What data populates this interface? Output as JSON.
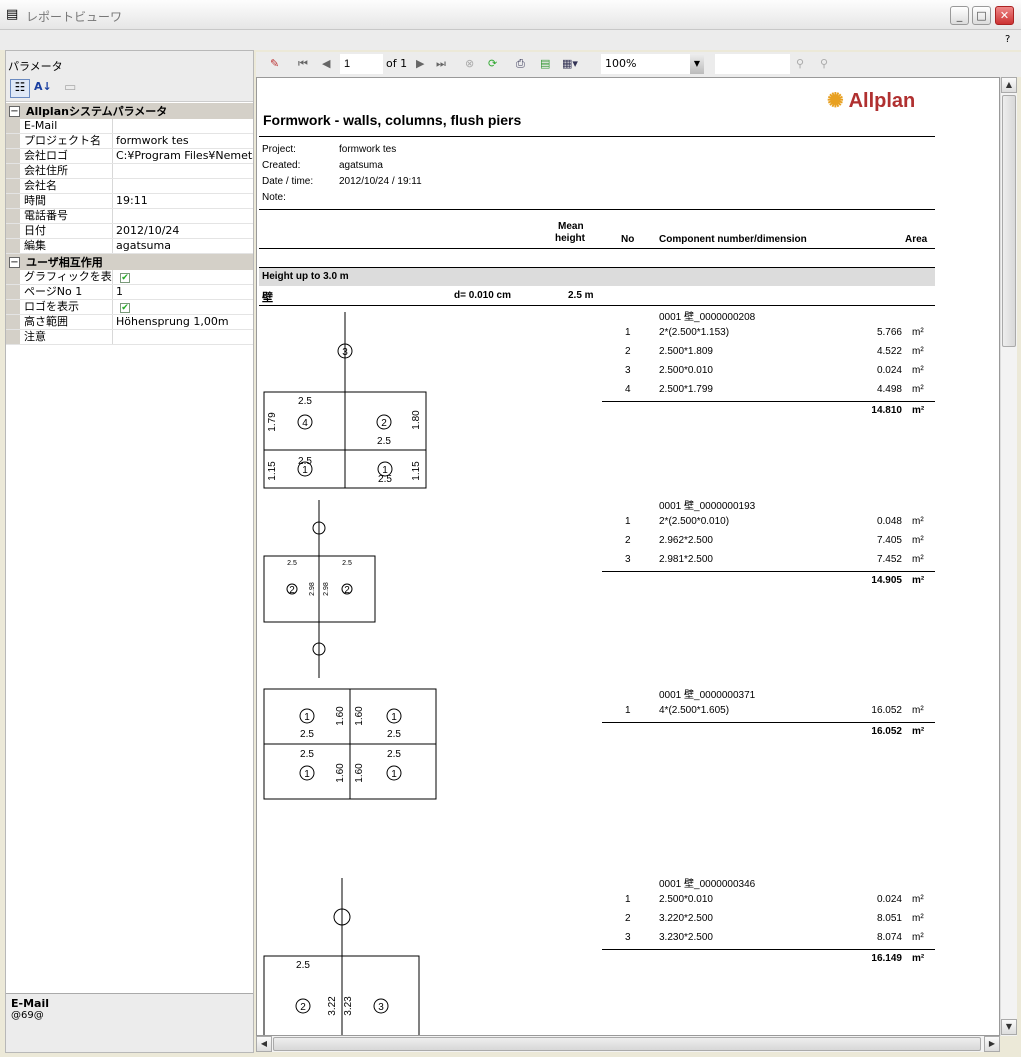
{
  "window": {
    "title": "レポートビューワ",
    "help": "?"
  },
  "left": {
    "title": "パラメータ",
    "categories": [
      {
        "name": "Allplanシステムパラメータ",
        "rows": [
          {
            "k": "E-Mail",
            "v": ""
          },
          {
            "k": "プロジェクト名",
            "v": "formwork tes"
          },
          {
            "k": "会社ロゴ",
            "v": "C:¥Program Files¥Nemetsc"
          },
          {
            "k": "会社住所",
            "v": ""
          },
          {
            "k": "会社名",
            "v": ""
          },
          {
            "k": "時間",
            "v": "19:11"
          },
          {
            "k": "電話番号",
            "v": ""
          },
          {
            "k": "日付",
            "v": "2012/10/24"
          },
          {
            "k": "編集",
            "v": "agatsuma"
          }
        ]
      },
      {
        "name": "ユーザ相互作用",
        "rows": [
          {
            "k": "グラフィックを表示",
            "v": "",
            "check": true
          },
          {
            "k": "ページNo 1",
            "v": "1"
          },
          {
            "k": "ロゴを表示",
            "v": "",
            "check": true
          },
          {
            "k": "高さ範囲",
            "v": "Höhensprung 1,00m"
          },
          {
            "k": "注意",
            "v": ""
          }
        ]
      }
    ],
    "desc": {
      "title": "E-Mail",
      "text": "@69@"
    }
  },
  "toolbar": {
    "page": "1",
    "of": "of 1",
    "zoom": "100%",
    "find": ""
  },
  "report": {
    "logo": "Allplan",
    "title": "Formwork - walls, columns, flush piers",
    "meta": [
      {
        "k": "Project:",
        "v": "formwork tes"
      },
      {
        "k": "Created:",
        "v": "agatsuma"
      },
      {
        "k": "Date / time:",
        "v": "2012/10/24  /  19:11"
      },
      {
        "k": "Note:",
        "v": ""
      }
    ],
    "headers": {
      "mean1": "Mean",
      "mean2": "height",
      "no": "No",
      "comp": "Component number/dimension",
      "area": "Area"
    },
    "group": "Height up to 3.0 m",
    "item": {
      "name": "壁",
      "d": "d= 0.010 cm",
      "h": "2.5 m"
    },
    "unit": "m²",
    "blocks": [
      {
        "id": "0001 壁_0000000208",
        "rows": [
          [
            "1",
            "2*(2.500*1.153)",
            "5.766"
          ],
          [
            "2",
            "2.500*1.809",
            "4.522"
          ],
          [
            "3",
            "2.500*0.010",
            "0.024"
          ],
          [
            "4",
            "2.500*1.799",
            "4.498"
          ]
        ],
        "total": "14.810"
      },
      {
        "id": "0001 壁_0000000193",
        "rows": [
          [
            "1",
            "2*(2.500*0.010)",
            "0.048"
          ],
          [
            "2",
            "2.962*2.500",
            "7.405"
          ],
          [
            "3",
            "2.981*2.500",
            "7.452"
          ]
        ],
        "total": "14.905"
      },
      {
        "id": "0001 壁_0000000371",
        "rows": [
          [
            "1",
            "4*(2.500*1.605)",
            "16.052"
          ]
        ],
        "total": "16.052"
      },
      {
        "id": "0001 壁_0000000346",
        "rows": [
          [
            "1",
            "2.500*0.010",
            "0.024"
          ],
          [
            "2",
            "3.220*2.500",
            "8.051"
          ],
          [
            "3",
            "3.230*2.500",
            "8.074"
          ]
        ],
        "total": "16.149"
      }
    ],
    "drawings": [
      [
        "3",
        "2.5",
        "4",
        "1.79",
        "2",
        "2.5",
        "1.80",
        "2.5",
        "1",
        "1.15",
        "1",
        "2.5",
        "1.15"
      ],
      [
        "2.5",
        "2.5",
        "2",
        "2.98",
        "2.98",
        "2"
      ],
      [
        "1",
        "2.5",
        "1.60",
        "1.60",
        "1",
        "2.5",
        "2.5",
        "1",
        "1.60",
        "1.60",
        "2.5",
        "1"
      ],
      [
        "2.5",
        "2",
        "3.22",
        "3.23",
        "3"
      ]
    ]
  },
  "colors": {
    "accent": "#b03030",
    "grid_category": "#d4d0c8"
  }
}
